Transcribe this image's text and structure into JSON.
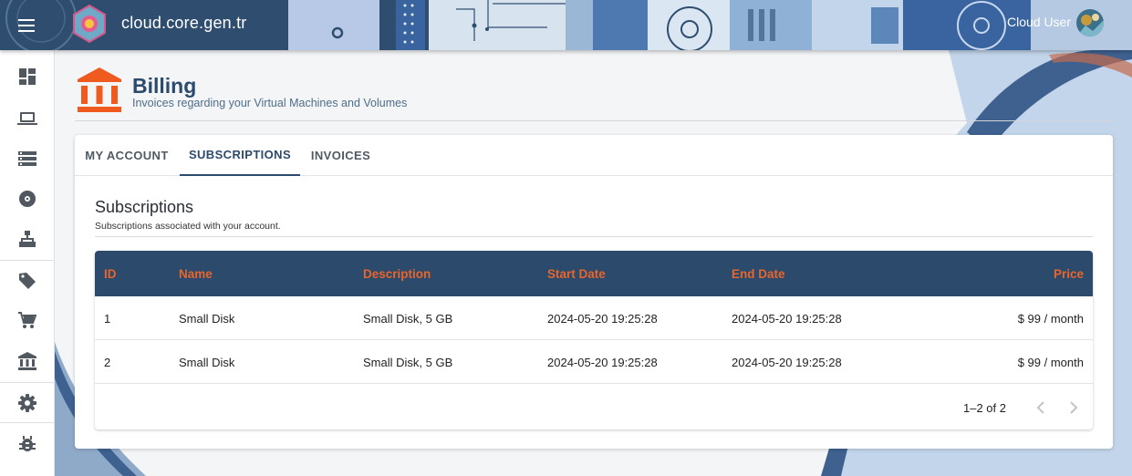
{
  "header": {
    "brand": "cloud.core.gen.tr",
    "user_name": "Cloud User"
  },
  "sidebar": {
    "items": [
      {
        "icon": "dashboard-icon"
      },
      {
        "icon": "laptop-icon"
      },
      {
        "icon": "storage-icon"
      },
      {
        "icon": "disc-icon"
      },
      {
        "icon": "network-icon"
      },
      {
        "icon": "tag-icon"
      },
      {
        "icon": "cart-icon"
      },
      {
        "icon": "bank-icon"
      },
      {
        "icon": "settings-icon"
      },
      {
        "icon": "bug-icon"
      }
    ]
  },
  "page": {
    "title": "Billing",
    "subtitle": "Invoices regarding your Virtual Machines and Volumes"
  },
  "tabs": [
    {
      "label": "MY ACCOUNT"
    },
    {
      "label": "SUBSCRIPTIONS"
    },
    {
      "label": "INVOICES"
    }
  ],
  "active_tab": "SUBSCRIPTIONS",
  "section": {
    "title": "Subscriptions",
    "subtitle": "Subscriptions associated with your account."
  },
  "table": {
    "columns": [
      "ID",
      "Name",
      "Description",
      "Start Date",
      "End Date",
      "Price"
    ],
    "rows": [
      {
        "id": "1",
        "name": "Small Disk",
        "description": "Small Disk, 5 GB",
        "start": "2024-05-20 19:25:28",
        "end": "2024-05-20 19:25:28",
        "price": "$ 99 / month"
      },
      {
        "id": "2",
        "name": "Small Disk",
        "description": "Small Disk, 5 GB",
        "start": "2024-05-20 19:25:28",
        "end": "2024-05-20 19:25:28",
        "price": "$ 99 / month"
      }
    ],
    "pagination": "1–2 of 2"
  },
  "colors": {
    "primary": "#2c4a6b",
    "accent": "#e8652b",
    "background": "#f4f5f7"
  }
}
